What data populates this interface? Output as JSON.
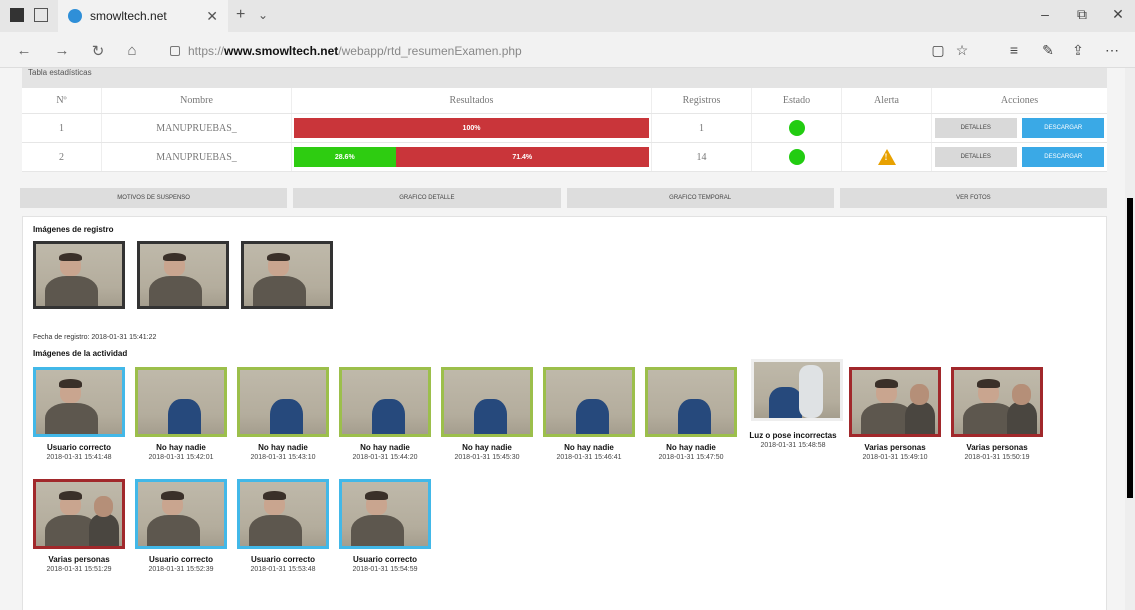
{
  "browser": {
    "tab_title": "smowltech.net",
    "url_prefix": "https://",
    "url_domain": "www.smowltech.net",
    "url_path": "/webapp/rtd_resumenExamen.php"
  },
  "panel": {
    "title": "Tabla estadísticas"
  },
  "table": {
    "headers": [
      "Nº",
      "Nombre",
      "Resultados",
      "Registros",
      "Estado",
      "Alerta",
      "Acciones"
    ],
    "rows": [
      {
        "num": "1",
        "name": "MANUPRUEBAS_",
        "results": [
          {
            "label": "100%",
            "value": 100,
            "color": "#c9353a"
          }
        ],
        "registros": "1",
        "estado_color": "#22cc11",
        "alerta": "",
        "btn_detail": "DETALLES",
        "btn_download": "DESCARGAR"
      },
      {
        "num": "2",
        "name": "MANUPRUEBAS_",
        "results": [
          {
            "label": "28.6%",
            "value": 28.6,
            "color": "#2ecc11"
          },
          {
            "label": "71.4%",
            "value": 71.4,
            "color": "#c9353a"
          }
        ],
        "registros": "14",
        "estado_color": "#22cc11",
        "alerta": "warning-icon",
        "btn_detail": "DETALLES",
        "btn_download": "DESCARGAR"
      }
    ]
  },
  "action_tabs": [
    "MOTIVOS DE SUSPENSO",
    "GRAFICO DETALLE",
    "GRAFICO TEMPORAL",
    "VER FOTOS"
  ],
  "registro": {
    "title": "Imágenes de registro",
    "date_text": "Fecha de registro: 2018-01-31 15:41:22"
  },
  "actividad": {
    "title": "Imágenes de la actividad",
    "items": [
      {
        "label": "Usuario correcto",
        "date": "2018-01-31 15:41:48",
        "border": "#42b8e8",
        "kind": "user"
      },
      {
        "label": "No hay nadie",
        "date": "2018-01-31 15:42:01",
        "border": "#9cbf4b",
        "kind": "empty"
      },
      {
        "label": "No hay nadie",
        "date": "2018-01-31 15:43:10",
        "border": "#9cbf4b",
        "kind": "empty"
      },
      {
        "label": "No hay nadie",
        "date": "2018-01-31 15:44:20",
        "border": "#9cbf4b",
        "kind": "empty"
      },
      {
        "label": "No hay nadie",
        "date": "2018-01-31 15:45:30",
        "border": "#9cbf4b",
        "kind": "empty"
      },
      {
        "label": "No hay nadie",
        "date": "2018-01-31 15:46:41",
        "border": "#9cbf4b",
        "kind": "empty"
      },
      {
        "label": "No hay nadie",
        "date": "2018-01-31 15:47:50",
        "border": "#9cbf4b",
        "kind": "empty"
      },
      {
        "label": "Luz o pose incorrectas",
        "date": "2018-01-31 15:48:58",
        "border": "#eeeeee",
        "kind": "stand"
      },
      {
        "label": "Varias personas",
        "date": "2018-01-31 15:49:10",
        "border": "#a1282b",
        "kind": "multi"
      },
      {
        "label": "Varias personas",
        "date": "2018-01-31 15:50:19",
        "border": "#a1282b",
        "kind": "multi"
      },
      {
        "label": "Varias personas",
        "date": "2018-01-31 15:51:29",
        "border": "#a1282b",
        "kind": "multi"
      },
      {
        "label": "Usuario correcto",
        "date": "2018-01-31 15:52:39",
        "border": "#42b8e8",
        "kind": "user"
      },
      {
        "label": "Usuario correcto",
        "date": "2018-01-31 15:53:48",
        "border": "#42b8e8",
        "kind": "user"
      },
      {
        "label": "Usuario correcto",
        "date": "2018-01-31 15:54:59",
        "border": "#42b8e8",
        "kind": "user"
      }
    ]
  }
}
